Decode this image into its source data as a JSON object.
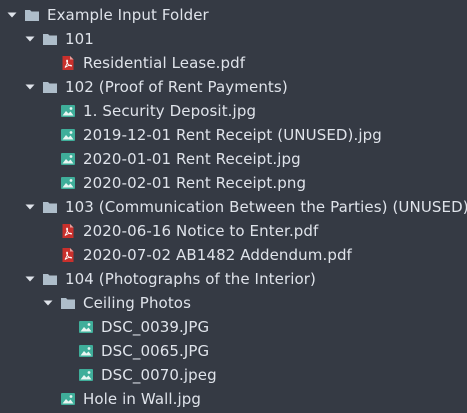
{
  "colors": {
    "background": "#353a44",
    "text": "#dfe3ea",
    "folder": "#aebdca",
    "arrow": "#dfe3ea",
    "pdf": "#c9302c",
    "image": "#3fae9a"
  },
  "tree": [
    {
      "label": "Example Input Folder",
      "type": "folder",
      "level": 0,
      "expanded": true
    },
    {
      "label": "101",
      "type": "folder",
      "level": 1,
      "expanded": true
    },
    {
      "label": "Residential Lease.pdf",
      "type": "pdf",
      "level": 2
    },
    {
      "label": "102 (Proof of Rent Payments)",
      "type": "folder",
      "level": 1,
      "expanded": true
    },
    {
      "label": "1. Security Deposit.jpg",
      "type": "image",
      "level": 2
    },
    {
      "label": "2019-12-01 Rent Receipt (UNUSED).jpg",
      "type": "image",
      "level": 2
    },
    {
      "label": "2020-01-01 Rent Receipt.jpg",
      "type": "image",
      "level": 2
    },
    {
      "label": "2020-02-01 Rent Receipt.png",
      "type": "image",
      "level": 2
    },
    {
      "label": "103 (Communication Between the Parties) (UNUSED)",
      "type": "folder",
      "level": 1,
      "expanded": true
    },
    {
      "label": "2020-06-16 Notice to Enter.pdf",
      "type": "pdf",
      "level": 2
    },
    {
      "label": "2020-07-02 AB1482 Addendum.pdf",
      "type": "pdf",
      "level": 2
    },
    {
      "label": "104 (Photographs of the Interior)",
      "type": "folder",
      "level": 1,
      "expanded": true
    },
    {
      "label": "Ceiling Photos",
      "type": "folder",
      "level": 2,
      "expanded": true
    },
    {
      "label": "DSC_0039.JPG",
      "type": "image",
      "level": 3
    },
    {
      "label": "DSC_0065.JPG",
      "type": "image",
      "level": 3
    },
    {
      "label": "DSC_0070.jpeg",
      "type": "image",
      "level": 3
    },
    {
      "label": "Hole in Wall.jpg",
      "type": "image",
      "level": 2
    }
  ]
}
